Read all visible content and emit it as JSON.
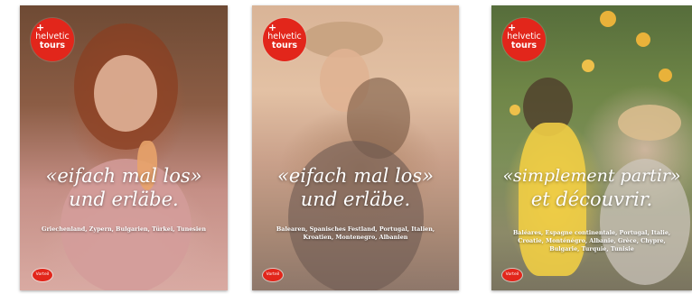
{
  "brand": {
    "cross": "+",
    "name_line1": "helvetic",
    "name_line2": "tours",
    "accent_color": "#e2261b",
    "badge_label": "Vorteil"
  },
  "catalogs": [
    {
      "slogan_line1": "«eifach mal los»",
      "slogan_line2": "und erläbe.",
      "destinations": "Griechenland, Zypern, Bulgarien, Türkei, Tunesien"
    },
    {
      "slogan_line1": "«eifach mal los»",
      "slogan_line2": "und erläbe.",
      "destinations": "Balearen, Spanisches Festland, Portugal, Italien, Kroatien, Montenegro, Albanien"
    },
    {
      "slogan_line1": "«simplement partir»",
      "slogan_line2": "et découvrir.",
      "destinations": "Baléares, Espagne continentale, Portugal, Italie, Croatie, Monténégro, Albanie, Grèce, Chypre, Bulgarie, Turquie, Tunisie"
    }
  ]
}
